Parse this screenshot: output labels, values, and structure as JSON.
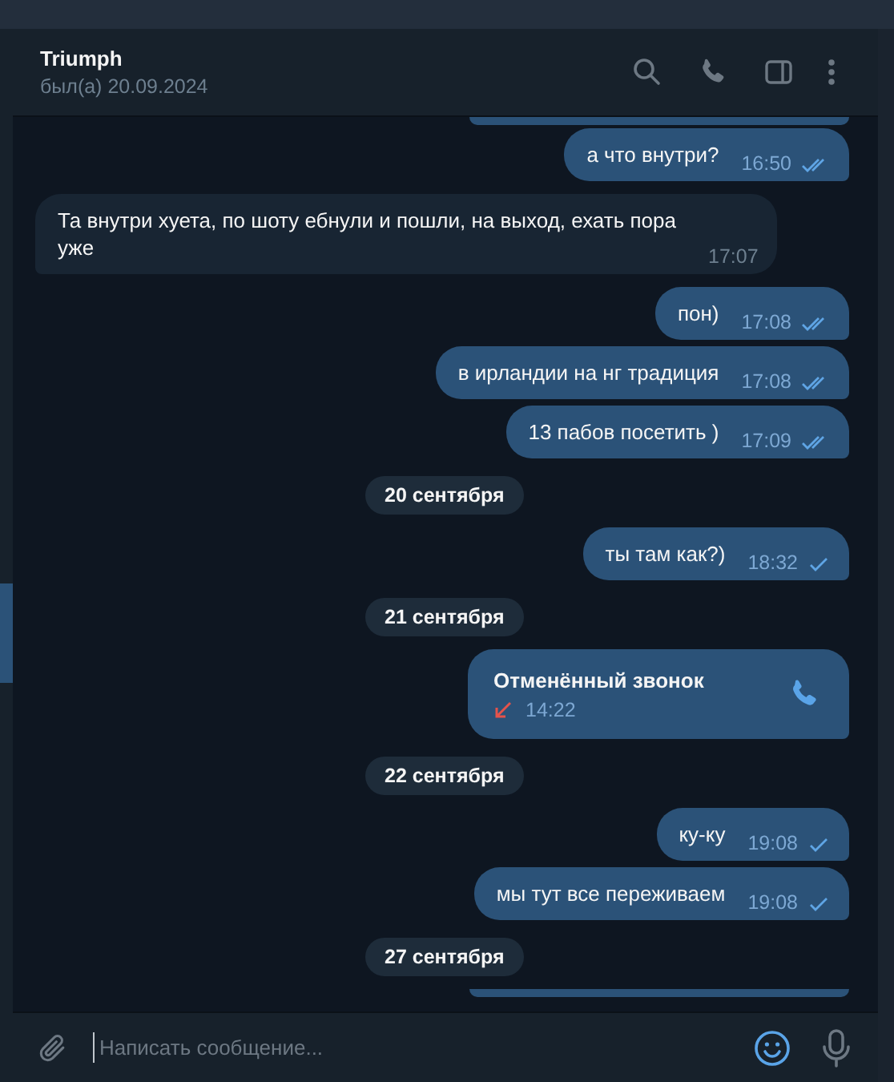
{
  "header": {
    "title": "Triumph",
    "status": "был(а) 20.09.2024"
  },
  "messages": [
    {
      "kind": "partial",
      "outgoing": true
    },
    {
      "kind": "text",
      "outgoing": true,
      "text": "а что внутри?",
      "time": "16:50",
      "read": true
    },
    {
      "kind": "text",
      "outgoing": false,
      "text": "Та внутри хуета, по шоту ебнули и пошли, на выход, ехать пора уже",
      "time": "17:07"
    },
    {
      "kind": "text",
      "outgoing": true,
      "text": "пон)",
      "time": "17:08",
      "read": true
    },
    {
      "kind": "text",
      "outgoing": true,
      "text": "в ирландии на нг традиция",
      "time": "17:08",
      "read": true
    },
    {
      "kind": "text",
      "outgoing": true,
      "text": "13 пабов посетить )",
      "time": "17:09",
      "read": true
    },
    {
      "kind": "date",
      "text": "20 сентября"
    },
    {
      "kind": "text",
      "outgoing": true,
      "text": "ты там как?)",
      "time": "18:32",
      "read": false
    },
    {
      "kind": "date",
      "text": "21 сентября"
    },
    {
      "kind": "call",
      "outgoing": true,
      "text": "Отменённый звонок",
      "time": "14:22"
    },
    {
      "kind": "date",
      "text": "22 сентября"
    },
    {
      "kind": "text",
      "outgoing": true,
      "text": "ку-ку",
      "time": "19:08",
      "read": false
    },
    {
      "kind": "text",
      "outgoing": true,
      "text": "мы тут все переживаем",
      "time": "19:08",
      "read": false
    },
    {
      "kind": "date",
      "text": "27 сентября"
    },
    {
      "kind": "partial",
      "outgoing": true
    }
  ],
  "composer": {
    "placeholder": "Написать сообщение..."
  }
}
